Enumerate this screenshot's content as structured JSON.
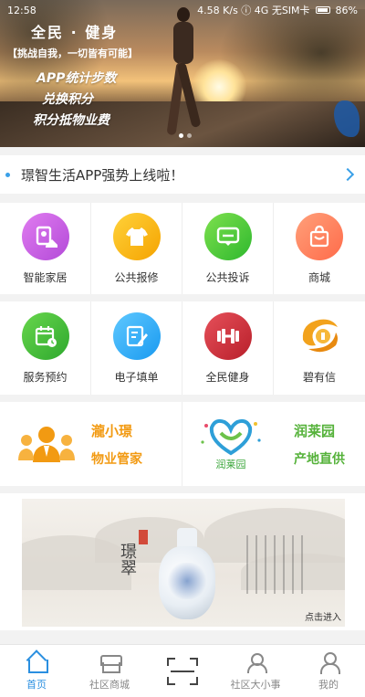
{
  "status_bar": {
    "time": "12:58",
    "center": "4.58 K/s ⓘ 4G 无SIM卡",
    "battery": "86%"
  },
  "banner": {
    "title": "全民 · 健身",
    "tagline": "【挑战自我，一切皆有可能】",
    "line1": "APP统计步数",
    "line2": "兑换积分",
    "line3": "积分抵物业费",
    "slides": 2,
    "active_slide": 1
  },
  "notice": {
    "text": "璟智生活APP强势上线啦！"
  },
  "grid1": [
    {
      "label": "智能家居",
      "icon": "smart-home-icon",
      "color": "#c85ae0"
    },
    {
      "label": "公共报修",
      "icon": "repair-shirt-icon",
      "color": "#f7b514"
    },
    {
      "label": "公共投诉",
      "icon": "message-icon",
      "color": "#3fc53a"
    },
    {
      "label": "商城",
      "icon": "shopping-bag-icon",
      "color": "#ff7f5c"
    }
  ],
  "grid2": [
    {
      "label": "服务预约",
      "icon": "calendar-icon",
      "color": "#46c23e"
    },
    {
      "label": "电子填单",
      "icon": "edit-form-icon",
      "color": "#2aa8f5"
    },
    {
      "label": "全民健身",
      "icon": "dumbbell-icon",
      "color": "#cc2f38"
    },
    {
      "label": "碧有信",
      "icon": "coin-icon",
      "color": "#f2a21c"
    }
  ],
  "partners": [
    {
      "name": "瀧小璟",
      "sub": "物业管家",
      "icon": "butler-icon",
      "color": "#f29a12"
    },
    {
      "name": "润莱园",
      "sub": "产地直供",
      "icon": "heart-logo-icon",
      "logo_text": "润莱园",
      "color": "#55b23a"
    }
  ],
  "ad": {
    "calligraphy": "璟翠",
    "enter_label": "点击进入"
  },
  "bottom_nav": [
    {
      "label": "首页",
      "icon": "home-icon",
      "active": true
    },
    {
      "label": "社区商城",
      "icon": "shop-icon",
      "active": false
    },
    {
      "label": "",
      "icon": "scan-icon",
      "active": false
    },
    {
      "label": "社区大小事",
      "icon": "people-icon",
      "active": false
    },
    {
      "label": "我的",
      "icon": "user-icon",
      "active": false
    }
  ]
}
